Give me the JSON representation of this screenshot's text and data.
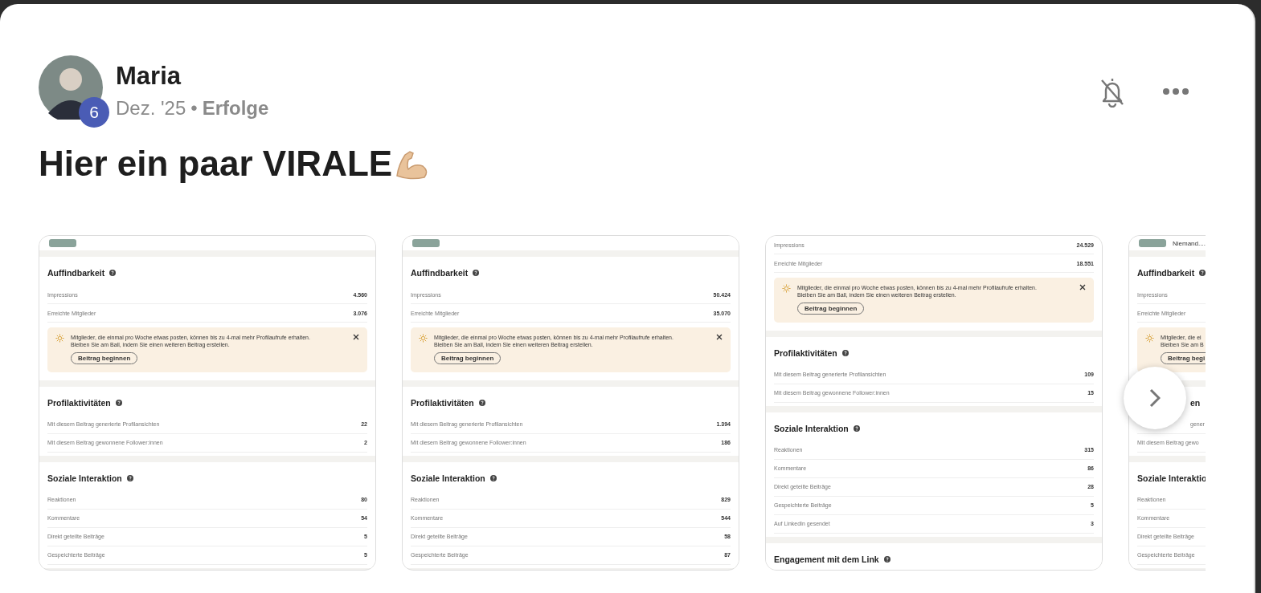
{
  "post": {
    "author": {
      "name": "Maria",
      "badge": "6"
    },
    "meta": {
      "date": "Dez. '25",
      "separator": "•",
      "category": "Erfolge"
    },
    "title": "Hier ein paar VIRALE"
  },
  "carousel": {
    "cards": [
      {
        "top": {
          "kind": "thumb"
        },
        "sections": [
          {
            "title": "Auffindbarkeit",
            "rows": [
              {
                "label": "Impressions",
                "value": "4.560"
              },
              {
                "label": "Erreichte Mitglieder",
                "value": "3.076"
              }
            ],
            "tip": {
              "lines": [
                "Mitglieder, die einmal pro Woche etwas posten, können bis zu 4-mal mehr Profilaufrufe erhalten.",
                "Bleiben Sie am Ball, indem Sie einen weiteren Beitrag erstellen."
              ],
              "button": "Beitrag beginnen"
            }
          },
          {
            "title": "Profilaktivitäten",
            "rows": [
              {
                "label": "Mit diesem Beitrag generierte Profilansichten",
                "value": "22"
              },
              {
                "label": "Mit diesem Beitrag gewonnene Follower:innen",
                "value": "2"
              }
            ]
          },
          {
            "title": "Soziale Interaktion",
            "rows": [
              {
                "label": "Reaktionen",
                "value": "80"
              },
              {
                "label": "Kommentare",
                "value": "54"
              },
              {
                "label": "Direkt geteilte Beiträge",
                "value": "5"
              },
              {
                "label": "Gespeichterte Beiträge",
                "value": "5"
              }
            ]
          }
        ]
      },
      {
        "top": {
          "kind": "thumb"
        },
        "sections": [
          {
            "title": "Auffindbarkeit",
            "rows": [
              {
                "label": "Impressions",
                "value": "50.424"
              },
              {
                "label": "Erreichte Mitglieder",
                "value": "35.070"
              }
            ],
            "tip": {
              "lines": [
                "Mitglieder, die einmal pro Woche etwas posten, können bis zu 4-mal mehr Profilaufrufe erhalten.",
                "Bleiben Sie am Ball, indem Sie einen weiteren Beitrag erstellen."
              ],
              "button": "Beitrag beginnen"
            }
          },
          {
            "title": "Profilaktivitäten",
            "rows": [
              {
                "label": "Mit diesem Beitrag generierte Profilansichten",
                "value": "1.394"
              },
              {
                "label": "Mit diesem Beitrag gewonnene Follower:innen",
                "value": "186"
              }
            ]
          },
          {
            "title": "Soziale Interaktion",
            "rows": [
              {
                "label": "Reaktionen",
                "value": "829"
              },
              {
                "label": "Kommentare",
                "value": "544"
              },
              {
                "label": "Direkt geteilte Beiträge",
                "value": "58"
              },
              {
                "label": "Gespeichterte Beiträge",
                "value": "87"
              }
            ]
          }
        ]
      },
      {
        "sections": [
          {
            "rows": [
              {
                "label": "Impressions",
                "value": "24.529"
              },
              {
                "label": "Erreichte Mitglieder",
                "value": "18.551"
              }
            ],
            "tip": {
              "lines": [
                "Mitglieder, die einmal pro Woche etwas posten, können bis zu 4-mal mehr Profilaufrufe erhalten.",
                "Bleiben Sie am Ball, indem Sie einen weiteren Beitrag erstellen."
              ],
              "button": "Beitrag beginnen"
            }
          },
          {
            "title": "Profilaktivitäten",
            "rows": [
              {
                "label": "Mit diesem Beitrag generierte Profilansichten",
                "value": "109"
              },
              {
                "label": "Mit diesem Beitrag gewonnene Follower:innen",
                "value": "15"
              }
            ]
          },
          {
            "title": "Soziale Interaktion",
            "rows": [
              {
                "label": "Reaktionen",
                "value": "315"
              },
              {
                "label": "Kommentare",
                "value": "86"
              },
              {
                "label": "Direkt geteilte Beiträge",
                "value": "28"
              },
              {
                "label": "Gespeichterte Beiträge",
                "value": "5"
              },
              {
                "label": "Auf LinkedIn gesendet",
                "value": "3"
              }
            ]
          },
          {
            "title": "Engagement mit dem Link"
          }
        ]
      },
      {
        "top": {
          "kind": "thumb",
          "text": "Niemand...."
        },
        "sections": [
          {
            "title": "Auffindbarkeit",
            "rows": [
              {
                "label": "Impressions"
              },
              {
                "label": "Erreichte Mitglieder"
              }
            ],
            "tip": {
              "lines": [
                "Mitglieder, die ei",
                "Bleiben Sie am B"
              ],
              "button": "Beitrag begi"
            }
          },
          {
            "title": "en",
            "covered": true,
            "rows": [
              {
                "label": "gener"
              },
              {
                "label": "Mit diesem Beitrag gewo"
              }
            ]
          },
          {
            "title": "Soziale Interaktio",
            "rows": [
              {
                "label": "Reaktionen"
              },
              {
                "label": "Kommentare"
              },
              {
                "label": "Direkt geteilte Beiträge"
              },
              {
                "label": "Gespeichterte Beiträge"
              }
            ]
          }
        ]
      }
    ]
  }
}
